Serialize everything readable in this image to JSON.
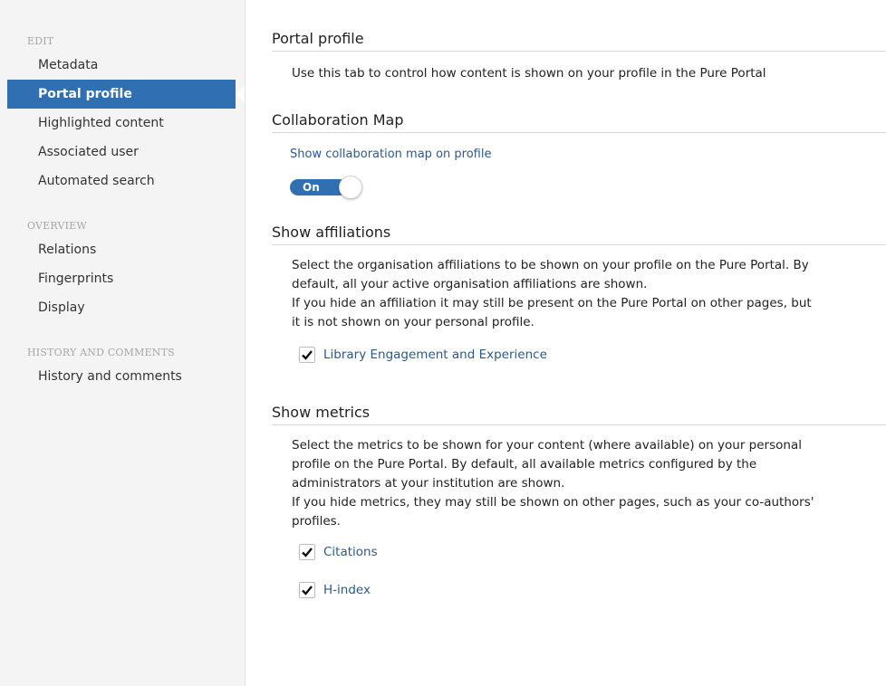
{
  "sidebar": {
    "sections": [
      {
        "heading": "EDIT",
        "items": [
          "Metadata",
          "Portal profile",
          "Highlighted content",
          "Associated user",
          "Automated search"
        ]
      },
      {
        "heading": "OVERVIEW",
        "items": [
          "Relations",
          "Fingerprints",
          "Display"
        ]
      },
      {
        "heading": "HISTORY AND COMMENTS",
        "items": [
          "History and comments"
        ]
      }
    ],
    "active_item": "Portal profile"
  },
  "portal_profile": {
    "title": "Portal profile",
    "description": "Use this tab to control how content is shown on your profile in the Pure Portal"
  },
  "collaboration_map": {
    "title": "Collaboration Map",
    "option_label": "Show collaboration map on profile",
    "toggle_label": "On",
    "toggle_on": true
  },
  "affiliations": {
    "title": "Show affiliations",
    "description_lines": [
      "Select the organisation affiliations to be shown on your profile on the Pure Portal. By",
      "default, all your active organisation affiliations are shown.",
      "If you hide an affiliation it may still be present on the Pure Portal on other pages, but",
      "it is not shown on your personal profile."
    ],
    "options": [
      {
        "label": "Library Engagement and Experience",
        "checked": true
      }
    ]
  },
  "metrics": {
    "title": "Show metrics",
    "description_lines": [
      "Select the metrics to be shown for your content (where available) on your personal",
      "profile on the Pure Portal. By default, all available metrics configured by the",
      "administrators at your institution are shown.",
      "If you hide metrics, they may still be shown on other pages, such as your co-authors'",
      "profiles."
    ],
    "options": [
      {
        "label": "Citations",
        "checked": true
      },
      {
        "label": "H-index",
        "checked": true
      }
    ]
  },
  "colors": {
    "accent": "#2f6fb2",
    "link": "#2b5a8c",
    "sidebar_bg": "#f4f4f4"
  }
}
